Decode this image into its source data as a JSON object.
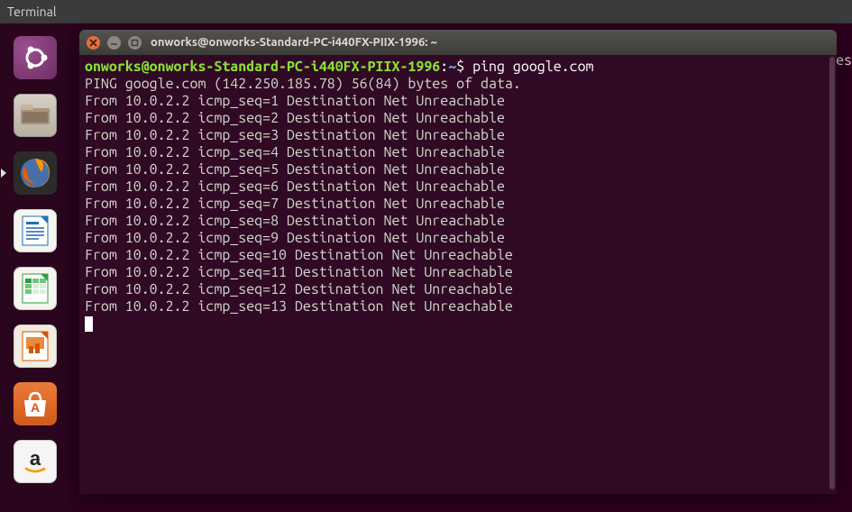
{
  "menuBar": {
    "appName": "Terminal"
  },
  "terminalWindow": {
    "title": "onworks@onworks-Standard-PC-i440FX-PIIX-1996: ~",
    "promptUser": "onworks@onworks-Standard-PC-i440FX-PIIX-1996",
    "promptPath": "~",
    "command": "ping google.com",
    "outputHeader": "PING google.com (142.250.185.78) 56(84) bytes of data.",
    "replies": [
      "From 10.0.2.2 icmp_seq=1 Destination Net Unreachable",
      "From 10.0.2.2 icmp_seq=2 Destination Net Unreachable",
      "From 10.0.2.2 icmp_seq=3 Destination Net Unreachable",
      "From 10.0.2.2 icmp_seq=4 Destination Net Unreachable",
      "From 10.0.2.2 icmp_seq=5 Destination Net Unreachable",
      "From 10.0.2.2 icmp_seq=6 Destination Net Unreachable",
      "From 10.0.2.2 icmp_seq=7 Destination Net Unreachable",
      "From 10.0.2.2 icmp_seq=8 Destination Net Unreachable",
      "From 10.0.2.2 icmp_seq=9 Destination Net Unreachable",
      "From 10.0.2.2 icmp_seq=10 Destination Net Unreachable",
      "From 10.0.2.2 icmp_seq=11 Destination Net Unreachable",
      "From 10.0.2.2 icmp_seq=12 Destination Net Unreachable",
      "From 10.0.2.2 icmp_seq=13 Destination Net Unreachable"
    ]
  },
  "partialBg": "es",
  "launcher": {
    "items": [
      {
        "name": "ubuntu-dash"
      },
      {
        "name": "files"
      },
      {
        "name": "firefox"
      },
      {
        "name": "libreoffice-writer"
      },
      {
        "name": "libreoffice-calc"
      },
      {
        "name": "libreoffice-impress"
      },
      {
        "name": "ubuntu-software"
      },
      {
        "name": "amazon"
      }
    ]
  }
}
